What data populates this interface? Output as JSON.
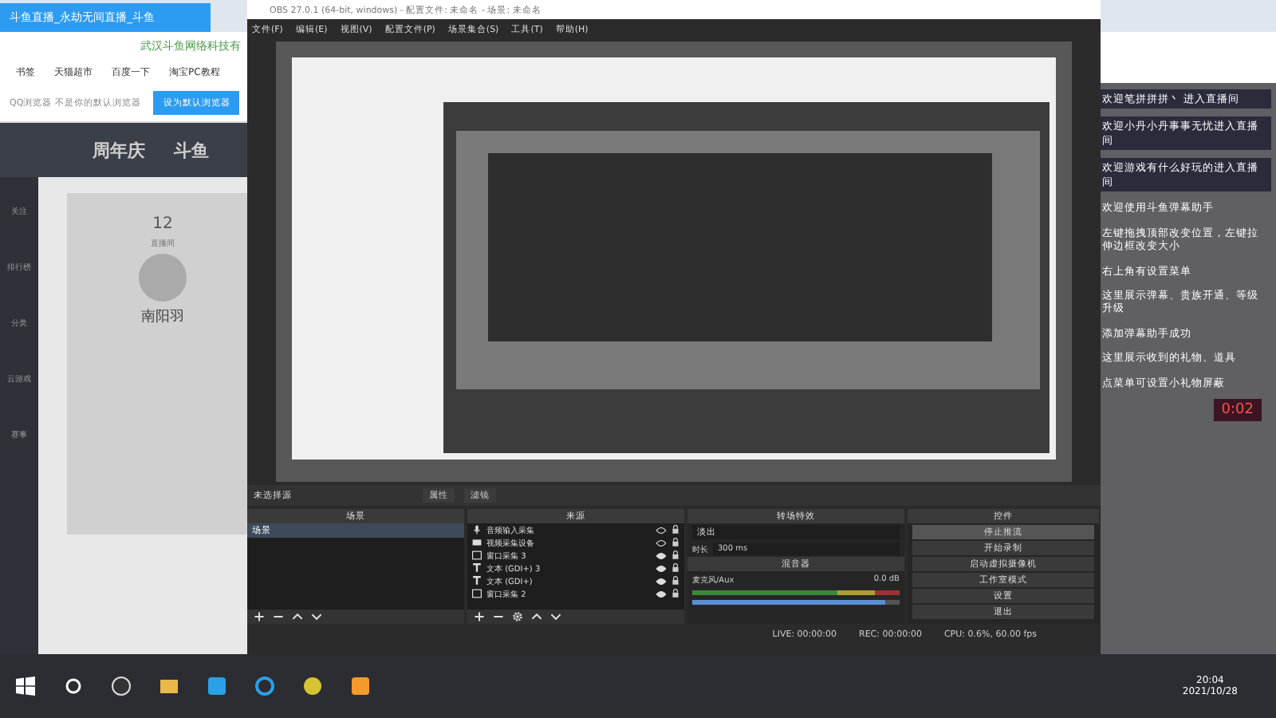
{
  "browser": {
    "tab_title": "斗鱼直播_永劫无间直播_斗鱼",
    "address": "武汉斗鱼网络科技有",
    "bookmarks": [
      "书签",
      "天猫超市",
      "百度一下",
      "淘宝PC教程"
    ],
    "default_notice": "QQ浏览器 不是你的默认浏览器",
    "default_button": "设为默认浏览器",
    "logos": [
      "周年庆",
      "斗鱼"
    ],
    "sidebar": [
      "关注",
      "排行榜",
      "分类",
      "云游戏",
      "赛事"
    ],
    "stat": "12",
    "stat_label": "直播间",
    "streamer": "南阳羽"
  },
  "obs": {
    "title": "OBS 27.0.1 (64-bit, windows) - 配置文件: 未命名 - 场景: 未命名",
    "menu": [
      "文件(F)",
      "编辑(E)",
      "视图(V)",
      "配置文件(P)",
      "场景集合(S)",
      "工具(T)",
      "帮助(H)"
    ],
    "source_toolbar": {
      "label": "未选择源",
      "buttons": [
        "属性",
        "滤镜"
      ]
    },
    "scenes": {
      "title": "场景",
      "items": [
        {
          "name": "场景",
          "selected": true
        }
      ]
    },
    "sources": {
      "title": "来源",
      "items": [
        {
          "name": "音频输入采集",
          "kind": "mic",
          "visible": false
        },
        {
          "name": "视频采集设备",
          "kind": "camera",
          "visible": false
        },
        {
          "name": "窗口采集 3",
          "kind": "window",
          "visible": true
        },
        {
          "name": "文本 (GDI+) 3",
          "kind": "text",
          "visible": true
        },
        {
          "name": "文本 (GDI+)",
          "kind": "text",
          "visible": true
        },
        {
          "name": "窗口采集 2",
          "kind": "window",
          "visible": true
        }
      ]
    },
    "transitions": {
      "title": "转场特效",
      "selected": "淡出",
      "duration_label": "时长",
      "duration": "300 ms"
    },
    "mixer": {
      "title": "混音器",
      "channel": "麦克风/Aux",
      "reading": "0.0 dB",
      "level": 0.93
    },
    "controls": {
      "title": "控件",
      "buttons": [
        "停止推流",
        "开始录制",
        "启动虚拟摄像机",
        "工作室模式",
        "设置",
        "退出"
      ]
    },
    "status": {
      "live": "LIVE: 00:00:00",
      "rec": "REC: 00:00:00",
      "cpu": "CPU: 0.6%, 60.00 fps"
    }
  },
  "chat": {
    "messages": [
      {
        "text": "欢迎笔拼拼拼丶 进入直播间",
        "kind": "welcome"
      },
      {
        "text": "欢迎小丹小丹事事无忧进入直播间",
        "kind": "welcome"
      },
      {
        "text": "欢迎游戏有什么好玩的进入直播间",
        "kind": "welcome"
      },
      {
        "text": "欢迎使用斗鱼弹幕助手",
        "kind": "tip"
      },
      {
        "text": "左键拖拽顶部改变位置，左键拉伸边框改变大小",
        "kind": "tip"
      },
      {
        "text": "右上角有设置菜单",
        "kind": "tip"
      },
      {
        "text": "这里展示弹幕、贵族开通、等级升级",
        "kind": "tip"
      },
      {
        "text": "添加弹幕助手成功",
        "kind": "tip"
      },
      {
        "text": "这里展示收到的礼物、道具",
        "kind": "tip"
      },
      {
        "text": "点菜单可设置小礼物屏蔽",
        "kind": "tip"
      }
    ],
    "timer": "0:02"
  },
  "taskbar": {
    "time": "20:04",
    "date": "2021/10/28"
  }
}
